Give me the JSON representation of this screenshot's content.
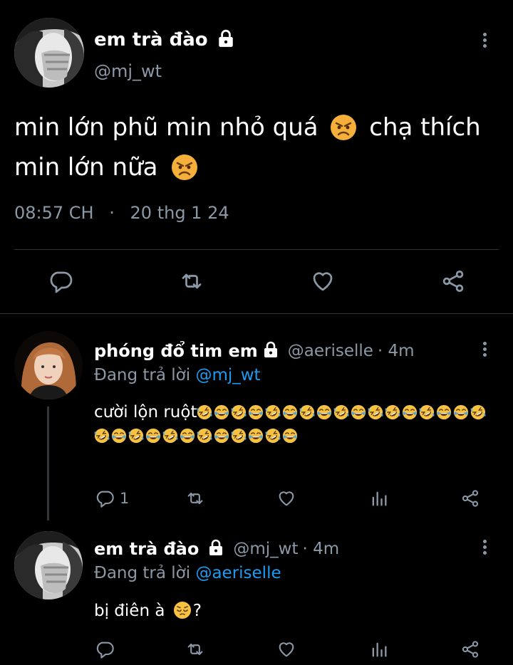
{
  "main_tweet": {
    "display_name": "em trà đào",
    "handle": "@mj_wt",
    "text_line1": "min lớn phũ min nhỏ quá",
    "text_line1b": "chạ thích",
    "text_line2": "min lớn nữa",
    "emoji_1": "angry-face",
    "emoji_2": "angry-face",
    "time": "08:57 CH",
    "separator": "·",
    "date": "20 thg 1 24"
  },
  "replies": [
    {
      "display_name": "phóng đổ tim em",
      "handle": "@aeriselle",
      "age": "· 4m",
      "replying_prefix": "Đang trả lời",
      "replying_to": "@mj_wt",
      "text": "cười lộn ruột",
      "emoji_sequence": [
        "rofl",
        "joy",
        "rofl",
        "joy",
        "rofl",
        "joy",
        "rofl",
        "joy",
        "rofl",
        "joy",
        "rofl",
        "rofl",
        "joy",
        "rofl",
        "joy",
        "joy",
        "rofl",
        "rofl",
        "joy",
        "rofl",
        "joy",
        "rofl",
        "joy",
        "rofl",
        "joy",
        "rofl",
        "joy",
        "rofl",
        "joy"
      ],
      "reply_count": "1"
    },
    {
      "display_name": "em trà đào",
      "handle": "@mj_wt",
      "age": "· 4m",
      "replying_prefix": "Đang trả lời",
      "replying_to": "@aeriselle",
      "text": "bị điên à",
      "text_suffix": "?",
      "emoji": "pensive-face"
    }
  ],
  "colors": {
    "background": "#000000",
    "text": "#e7e9ea",
    "secondary": "#8b98a5",
    "link": "#1d9bf0",
    "divider": "#2f3336"
  }
}
